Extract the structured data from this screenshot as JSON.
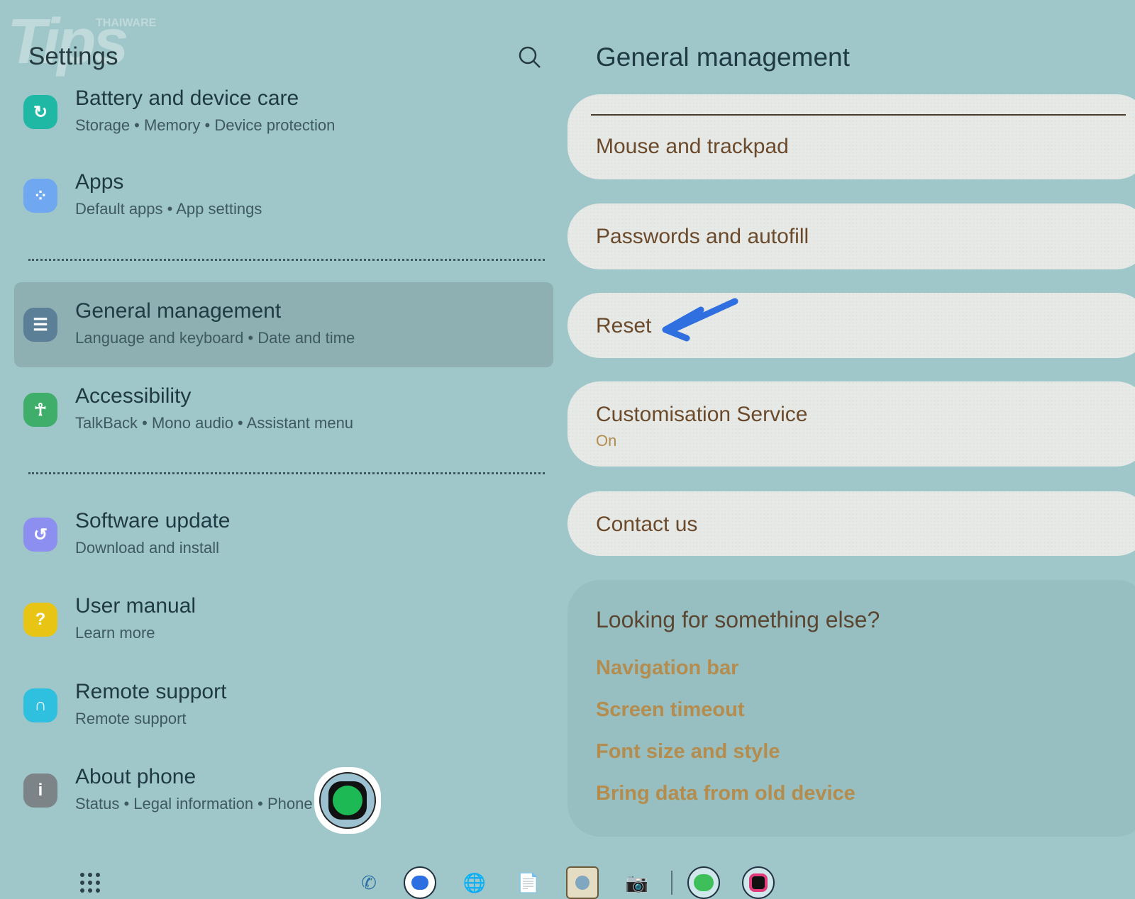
{
  "watermark": {
    "main": "Tips",
    "sub": "THAIWARE"
  },
  "left": {
    "title": "Settings",
    "items": [
      {
        "title": "Battery and device care",
        "sub": "Storage  •  Memory  •  Device protection",
        "icon": "battery-care-icon",
        "color": "#1fb8a4"
      },
      {
        "title": "Apps",
        "sub": "Default apps  •  App settings",
        "icon": "apps-icon",
        "color": "#6fa8f0"
      },
      {
        "title": "General management",
        "sub": "Language and keyboard  •  Date and time",
        "icon": "sliders-icon",
        "color": "#5b7f96"
      },
      {
        "title": "Accessibility",
        "sub": "TalkBack  •  Mono audio  •  Assistant menu",
        "icon": "accessibility-icon",
        "color": "#3fae6a"
      },
      {
        "title": "Software update",
        "sub": "Download and install",
        "icon": "software-update-icon",
        "color": "#8c8ff0"
      },
      {
        "title": "User manual",
        "sub": "Learn more",
        "icon": "user-manual-icon",
        "color": "#e8c514"
      },
      {
        "title": "Remote support",
        "sub": "Remote support",
        "icon": "headset-icon",
        "color": "#2fc0e0"
      },
      {
        "title": "About phone",
        "sub": "Status  •  Legal information  •  Phone name",
        "icon": "info-icon",
        "color": "#7c8488"
      }
    ]
  },
  "right": {
    "title": "General management",
    "cards": [
      {
        "title": "Mouse and trackpad"
      },
      {
        "title": "Passwords and autofill"
      },
      {
        "title": "Reset"
      },
      {
        "title": "Customisation Service",
        "sub": "On"
      },
      {
        "title": "Contact us"
      }
    ],
    "suggest": {
      "heading": "Looking for something else?",
      "links": [
        "Navigation bar",
        "Screen timeout",
        "Font size and style",
        "Bring data from old device"
      ]
    }
  },
  "accent": "#b38c4e",
  "dock": [
    "apps-grid-icon",
    "phone-icon",
    "messages-icon",
    "internet-icon",
    "notes-icon",
    "gallery-icon",
    "camera-icon",
    "line-icon",
    "app-icon"
  ]
}
